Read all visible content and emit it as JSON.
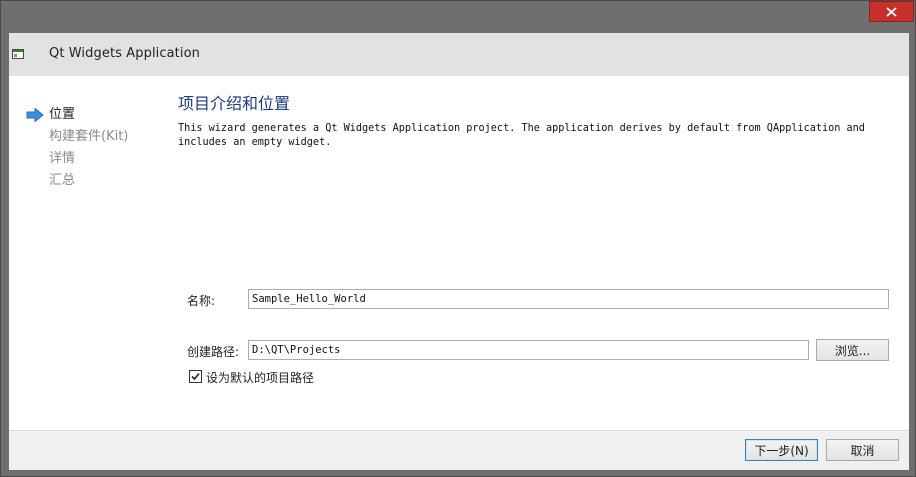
{
  "window": {
    "title": "Qt Widgets Application",
    "close_icon": "close-icon"
  },
  "sidebar": {
    "steps": [
      {
        "label": "位置",
        "current": true
      },
      {
        "label": "构建套件(Kit)",
        "current": false
      },
      {
        "label": "详情",
        "current": false
      },
      {
        "label": "汇总",
        "current": false
      }
    ]
  },
  "page": {
    "title": "项目介绍和位置",
    "description_line1": "This wizard generates a Qt Widgets Application project. The application derives by default from QApplication and",
    "description_line2": "includes an empty widget."
  },
  "form": {
    "name_label": "名称:",
    "name_value": "Sample_Hello_World",
    "path_label": "创建路径:",
    "path_value": "D:\\QT\\Projects",
    "browse_label": "浏览...",
    "default_path_label": "设为默认的项目路径",
    "default_path_checked": true
  },
  "footer": {
    "next_label": "下一步(N)",
    "cancel_label": "取消"
  },
  "colors": {
    "title_bar": "#6f6f6f",
    "close_button": "#c7302b",
    "page_title": "#1f3a78",
    "accent_arrow": "#3b8ee0"
  }
}
